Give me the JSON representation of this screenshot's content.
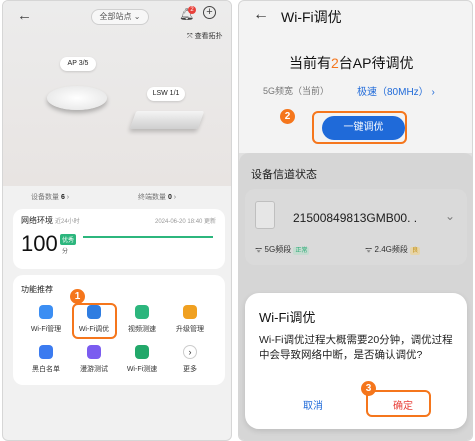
{
  "left": {
    "site_selector": "全部站点",
    "notification_count": "2",
    "view_topology": "查看拓扑",
    "ap_label": "AP 3/5",
    "lsw_label": "LSW 1/1",
    "device_count_label": "设备数量",
    "device_count_value": "6",
    "terminal_count_label": "终端数量",
    "terminal_count_value": "0",
    "network_title": "网络环境",
    "network_period": "近24小时",
    "network_time": "2024-06-20 18:40 更新",
    "score": "100",
    "score_badge": "优秀",
    "score_unit": "分",
    "features_title": "功能推荐",
    "features": [
      {
        "label": "Wi-Fi管理",
        "icon": "wifi-manage-icon",
        "color": "#3b8ef3"
      },
      {
        "label": "Wi-Fi调优",
        "icon": "wifi-optimize-icon",
        "color": "#2f7de1"
      },
      {
        "label": "视频测速",
        "icon": "video-speed-icon",
        "color": "#2cb67d"
      },
      {
        "label": "升级管理",
        "icon": "upgrade-icon",
        "color": "#f0a020"
      },
      {
        "label": "黑白名单",
        "icon": "blacklist-icon",
        "color": "#3b7bf0"
      },
      {
        "label": "漫游测试",
        "icon": "roaming-icon",
        "color": "#7b5cf0"
      },
      {
        "label": "Wi-Fi测速",
        "icon": "wifi-speed-icon",
        "color": "#22a86a"
      },
      {
        "label": "更多",
        "icon": "more-icon",
        "color": "#ffffff"
      }
    ],
    "step1": "1"
  },
  "right": {
    "title": "Wi-Fi调优",
    "pending_prefix": "当前有",
    "pending_count": "2",
    "pending_suffix": "台AP待调优",
    "band_label": "5G频宽（当前）",
    "band_value": "极速（80MHz）",
    "optimize_button": "一键调优",
    "step2": "2",
    "channel_status_title": "设备信道状态",
    "device_sn": "21500849813GMB00. .",
    "band5_label": "5G频段",
    "band5_status": "正常",
    "band24_label": "2.4G频段",
    "band24_status": "良",
    "dialog": {
      "title": "Wi-Fi调优",
      "message": "Wi-Fi调优过程大概需要20分钟，调优过程中会导致网络中断，是否确认调优?",
      "cancel": "取消",
      "confirm": "确定"
    },
    "step3": "3"
  },
  "colors": {
    "accent": "#1f6ad9",
    "orange": "#f5761c",
    "green": "#2cb67d"
  }
}
